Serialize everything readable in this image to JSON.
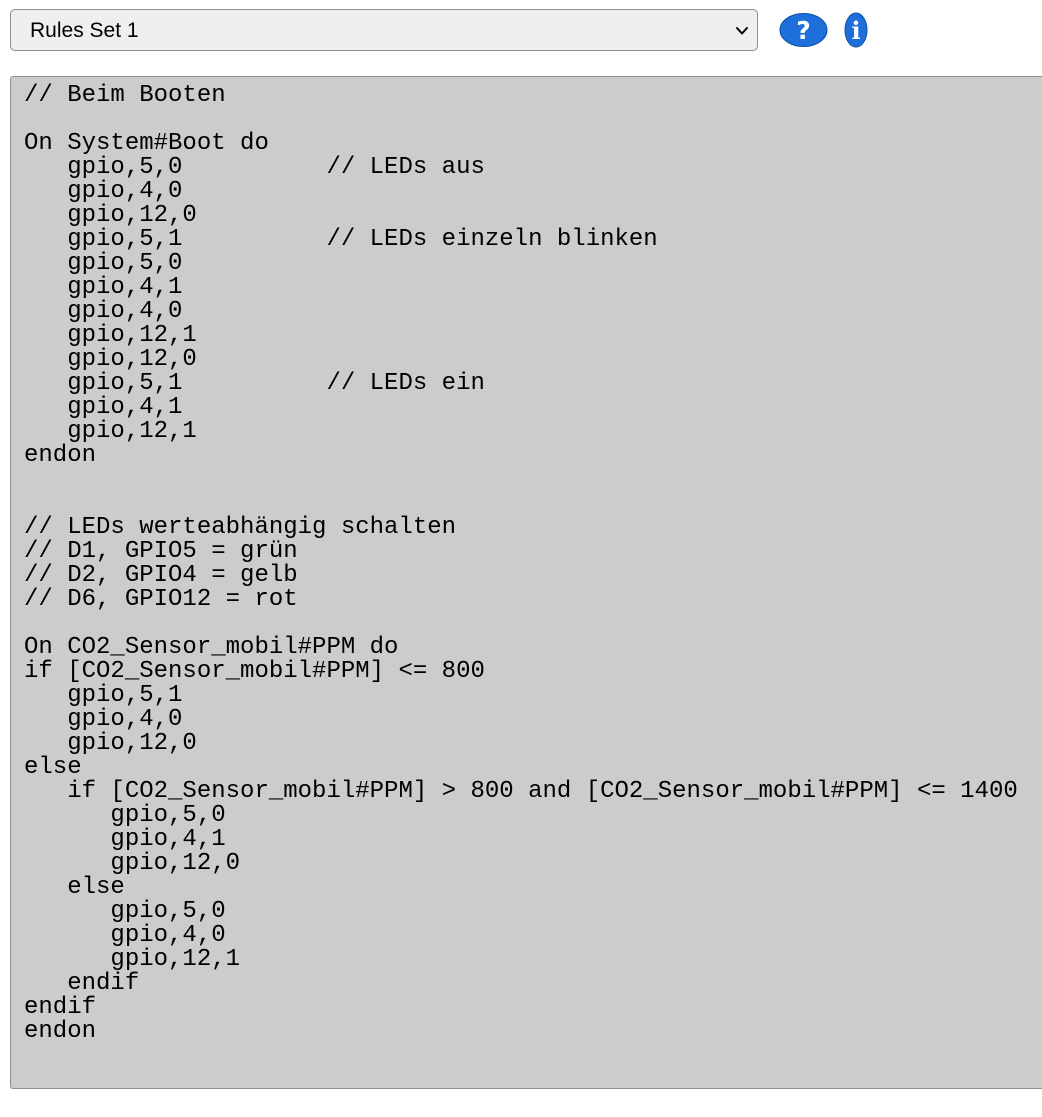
{
  "rules_selector": {
    "selected": "Rules Set 1"
  },
  "icons": {
    "help": "help-icon",
    "info": "info-icon",
    "dropdown": "chevron-down-icon"
  },
  "colors": {
    "icon_blue": "#1e6fd9",
    "editor_background": "#cccccc",
    "select_background": "#efefef"
  },
  "editor": {
    "lines": [
      "// Beim Booten",
      "",
      "On System#Boot do",
      "   gpio,5,0          // LEDs aus",
      "   gpio,4,0",
      "   gpio,12,0",
      "   gpio,5,1          // LEDs einzeln blinken",
      "   gpio,5,0",
      "   gpio,4,1",
      "   gpio,4,0",
      "   gpio,12,1",
      "   gpio,12,0",
      "   gpio,5,1          // LEDs ein",
      "   gpio,4,1",
      "   gpio,12,1",
      "endon",
      "",
      "",
      "// LEDs werteabhängig schalten",
      "// D1, GPIO5 = grün",
      "// D2, GPIO4 = gelb",
      "// D6, GPIO12 = rot",
      "",
      "On CO2_Sensor_mobil#PPM do",
      "if [CO2_Sensor_mobil#PPM] <= 800",
      "   gpio,5,1",
      "   gpio,4,0",
      "   gpio,12,0",
      "else",
      "   if [CO2_Sensor_mobil#PPM] > 800 and [CO2_Sensor_mobil#PPM] <= 1400",
      "      gpio,5,0",
      "      gpio,4,1",
      "      gpio,12,0",
      "   else",
      "      gpio,5,0",
      "      gpio,4,0",
      "      gpio,12,1",
      "   endif",
      "endif",
      "endon"
    ]
  }
}
